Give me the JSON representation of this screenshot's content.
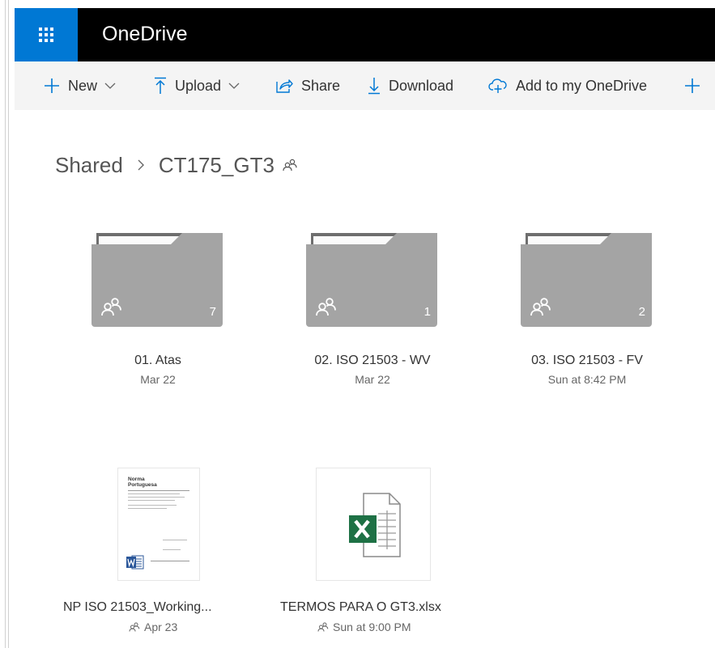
{
  "app": {
    "title": "OneDrive"
  },
  "toolbar": {
    "new_label": "New",
    "upload_label": "Upload",
    "share_label": "Share",
    "download_label": "Download",
    "add_to_onedrive_label": "Add to my OneDrive",
    "icons": [
      "plus-icon",
      "upload-icon",
      "share-icon",
      "download-icon",
      "add-cloud-icon"
    ]
  },
  "breadcrumb": {
    "root": "Shared",
    "current": "CT175_GT3"
  },
  "folders": [
    {
      "name": "01. Atas",
      "date": "Mar 22",
      "count": "7"
    },
    {
      "name": "02. ISO 21503 - WV",
      "date": "Mar 22",
      "count": "1"
    },
    {
      "name": "03. ISO 21503 - FV",
      "date": "Sun at 8:42 PM",
      "count": "2"
    }
  ],
  "files": [
    {
      "name": "NP ISO 21503_Working...",
      "date": "Apr 23",
      "type": "word",
      "thumb_heading": "Norma Portuguesa"
    },
    {
      "name": "TERMOS PARA O GT3.xlsx",
      "date": "Sun at 9:00 PM",
      "type": "excel"
    }
  ],
  "colors": {
    "accent": "#0078d4",
    "excel_green": "#1e7145",
    "word_blue": "#2b579a",
    "folder_gray": "#a4a4a4"
  }
}
